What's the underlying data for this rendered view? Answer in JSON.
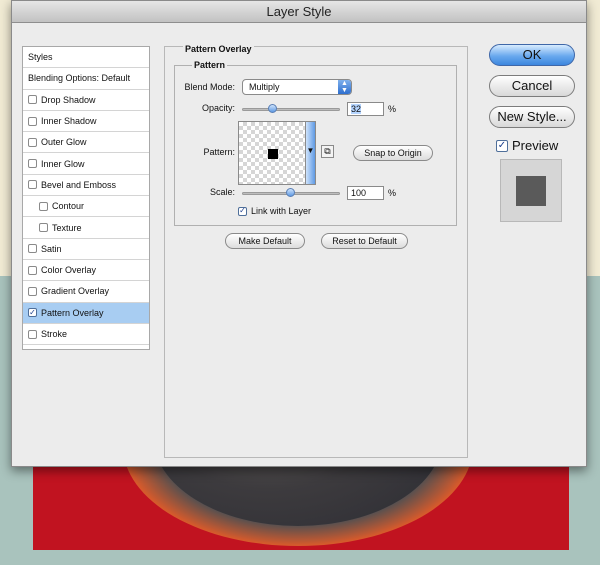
{
  "dialog": {
    "title": "Layer Style"
  },
  "styles_panel": {
    "header": "Styles",
    "items": [
      {
        "label": "Blending Options: Default",
        "checkbox": false,
        "checked": false,
        "sub": false,
        "active": false
      },
      {
        "label": "Drop Shadow",
        "checkbox": true,
        "checked": false,
        "sub": false,
        "active": false
      },
      {
        "label": "Inner Shadow",
        "checkbox": true,
        "checked": false,
        "sub": false,
        "active": false
      },
      {
        "label": "Outer Glow",
        "checkbox": true,
        "checked": false,
        "sub": false,
        "active": false
      },
      {
        "label": "Inner Glow",
        "checkbox": true,
        "checked": false,
        "sub": false,
        "active": false
      },
      {
        "label": "Bevel and Emboss",
        "checkbox": true,
        "checked": false,
        "sub": false,
        "active": false
      },
      {
        "label": "Contour",
        "checkbox": true,
        "checked": false,
        "sub": true,
        "active": false
      },
      {
        "label": "Texture",
        "checkbox": true,
        "checked": false,
        "sub": true,
        "active": false
      },
      {
        "label": "Satin",
        "checkbox": true,
        "checked": false,
        "sub": false,
        "active": false
      },
      {
        "label": "Color Overlay",
        "checkbox": true,
        "checked": false,
        "sub": false,
        "active": false
      },
      {
        "label": "Gradient Overlay",
        "checkbox": true,
        "checked": false,
        "sub": false,
        "active": false
      },
      {
        "label": "Pattern Overlay",
        "checkbox": true,
        "checked": true,
        "sub": false,
        "active": true
      },
      {
        "label": "Stroke",
        "checkbox": true,
        "checked": false,
        "sub": false,
        "active": false
      }
    ]
  },
  "pattern_overlay": {
    "section_title": "Pattern Overlay",
    "group_title": "Pattern",
    "blend_mode_label": "Blend Mode:",
    "blend_mode_value": "Multiply",
    "opacity_label": "Opacity:",
    "opacity_value": "32",
    "opacity_fraction": 0.32,
    "percent_sign": "%",
    "pattern_label": "Pattern:",
    "snap_button": "Snap to Origin",
    "scale_label": "Scale:",
    "scale_value": "100",
    "scale_fraction": 0.5,
    "link_label": "Link with Layer",
    "link_checked": true,
    "make_default_button": "Make Default",
    "reset_default_button": "Reset to Default"
  },
  "side_buttons": {
    "ok": "OK",
    "cancel": "Cancel",
    "new_style": "New Style...",
    "preview_label": "Preview",
    "preview_checked": true
  },
  "colors": {
    "accent": "#3d86de",
    "selection": "#a8cdf2",
    "canvas_red": "#c11320"
  }
}
